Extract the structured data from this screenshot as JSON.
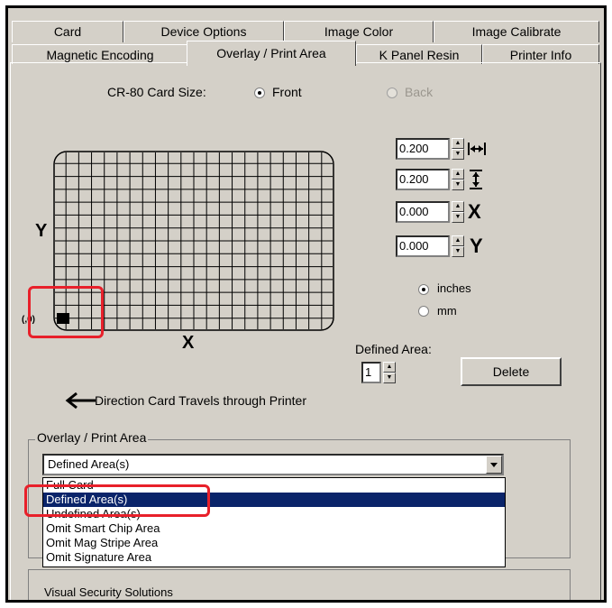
{
  "tabs_row1": [
    "Card",
    "Device Options",
    "Image Color",
    "Image Calibrate"
  ],
  "tabs_row2": [
    "Magnetic Encoding",
    "Overlay / Print Area",
    "K Panel Resin",
    "Printer Info"
  ],
  "card_size_label": "CR-80 Card Size:",
  "side_front": "Front",
  "side_back": "Back",
  "front_selected": true,
  "axis_y": "Y",
  "axis_x": "X",
  "origin_label": "(,0)",
  "spinners": [
    {
      "value": "0.200",
      "icon": "width-arrows-icon"
    },
    {
      "value": "0.200",
      "icon": "height-arrows-icon"
    },
    {
      "value": "0.000",
      "glyph": "X"
    },
    {
      "value": "0.000",
      "glyph": "Y"
    }
  ],
  "units": {
    "inches": "inches",
    "mm": "mm",
    "selected": "inches"
  },
  "defined_area_label": "Defined Area:",
  "defined_area_value": "1",
  "delete_label": "Delete",
  "direction_text": "Direction Card Travels through Printer",
  "overlay_group_label": "Overlay / Print Area",
  "dropdown_value": "Defined Area(s)",
  "dropdown_options": [
    "Full Card",
    "Defined Area(s)",
    "Undefined Area(s)",
    "Omit Smart Chip Area",
    "Omit Mag Stripe Area",
    "Omit Signature Area"
  ],
  "dropdown_selected_index": 1,
  "bottom_group_text": "Visual Security Solutions",
  "highlight_color": "#e8202a",
  "selection_color": "#0a246a"
}
